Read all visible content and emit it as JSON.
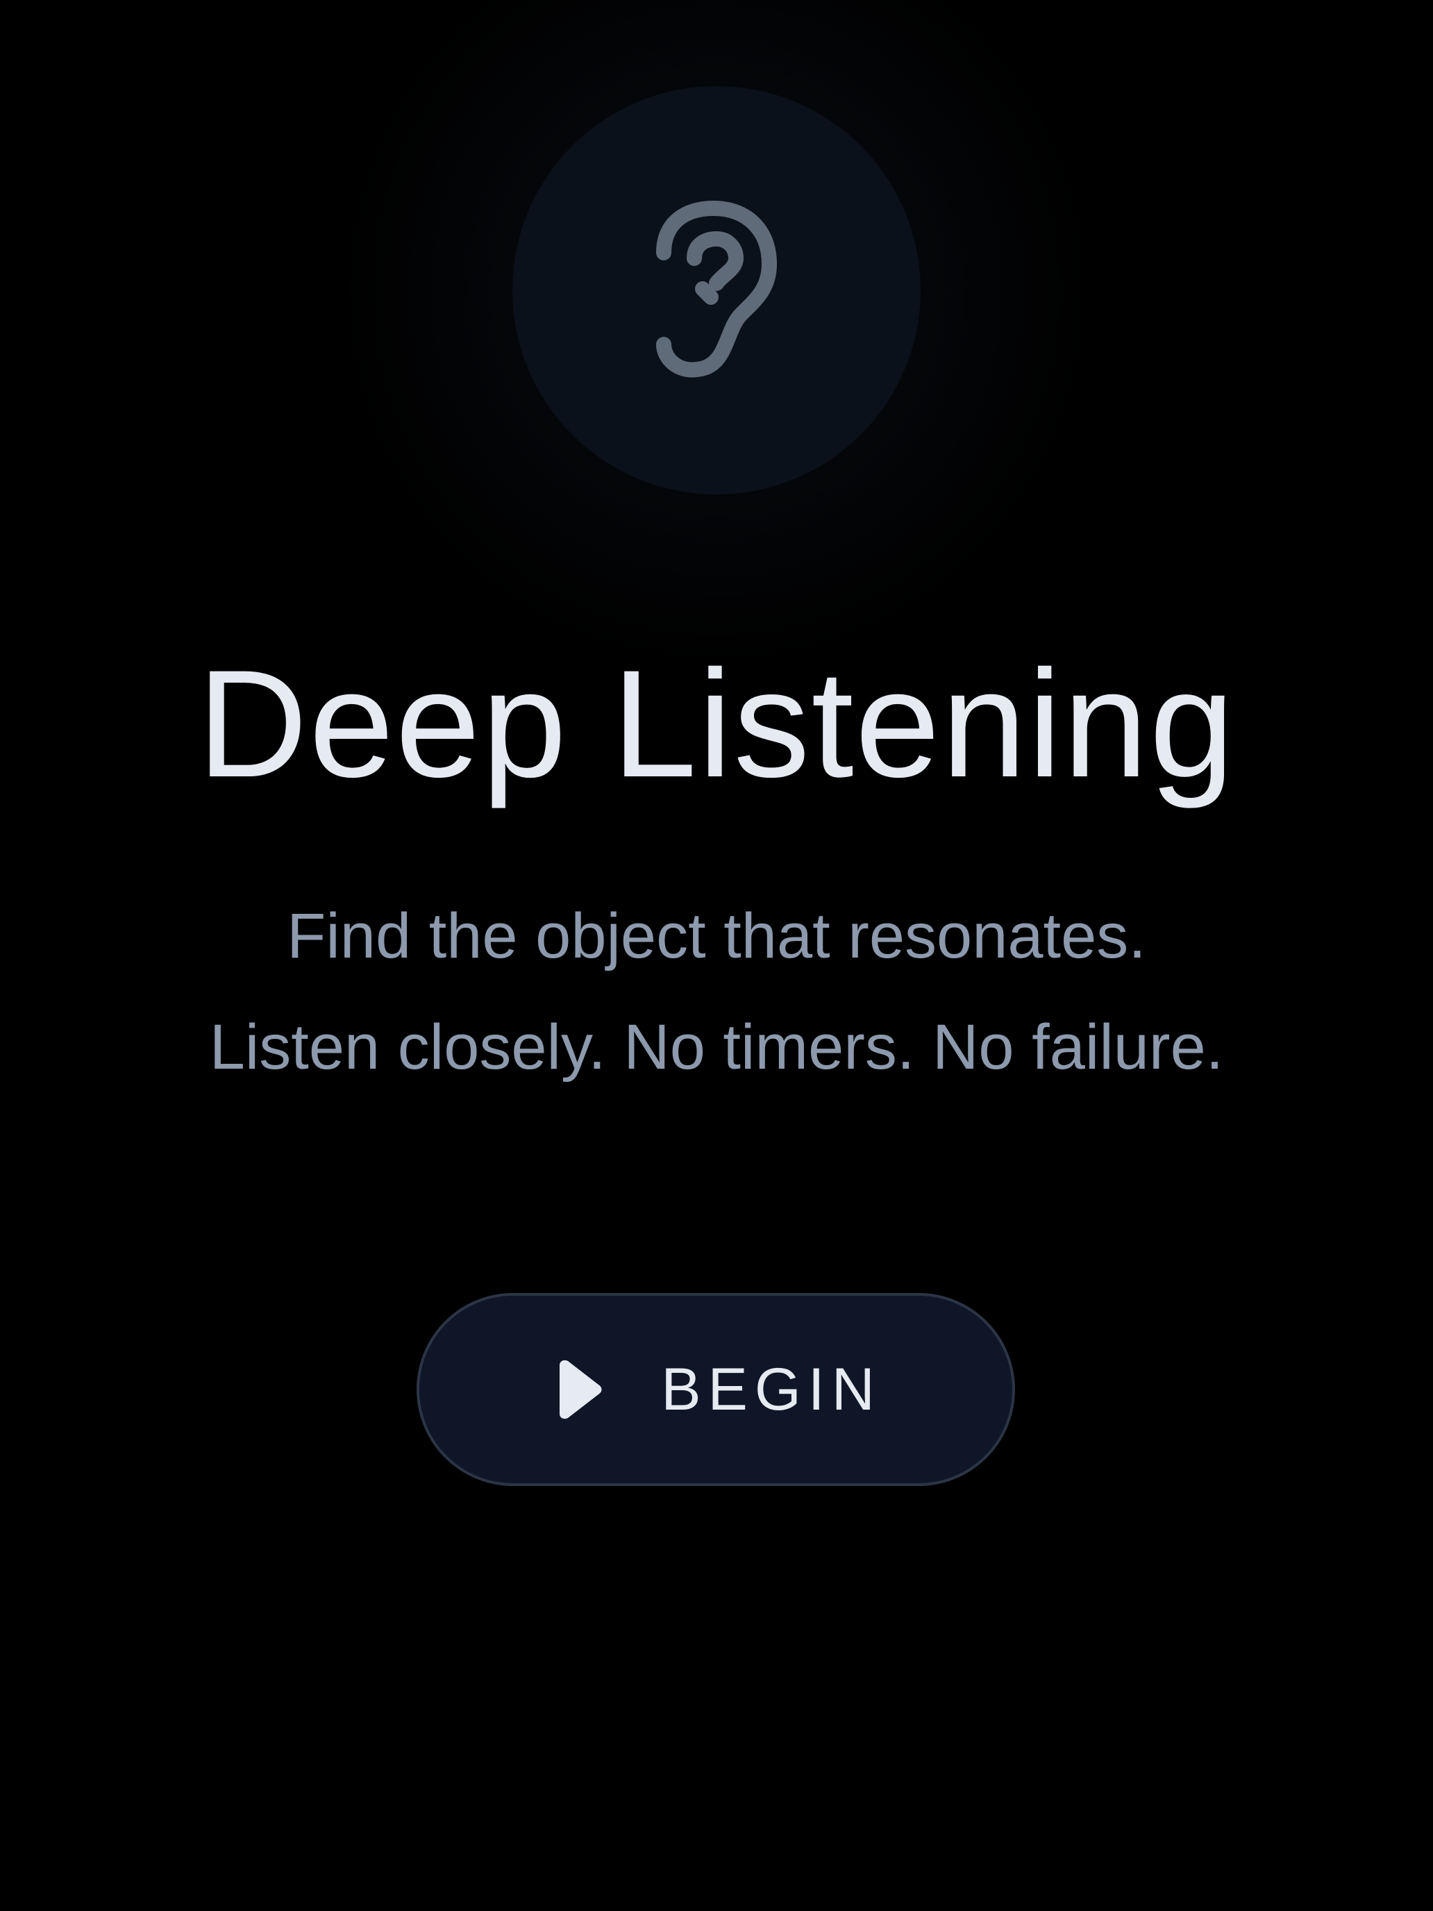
{
  "hero": {
    "icon": "ear-icon",
    "icon_color": "#5f6b79",
    "circle_color": "#0b111a"
  },
  "title": "Deep Listening",
  "subtitle": {
    "line1": "Find the object that resonates.",
    "line2": "Listen closely. No timers. No failure."
  },
  "begin_button": {
    "label": "BEGIN",
    "icon": "play-icon"
  },
  "colors": {
    "background": "#000000",
    "title": "#e6ebf2",
    "subtitle": "#8d99ad",
    "button_bg": "#0e1627",
    "button_border": "#2b3546"
  }
}
